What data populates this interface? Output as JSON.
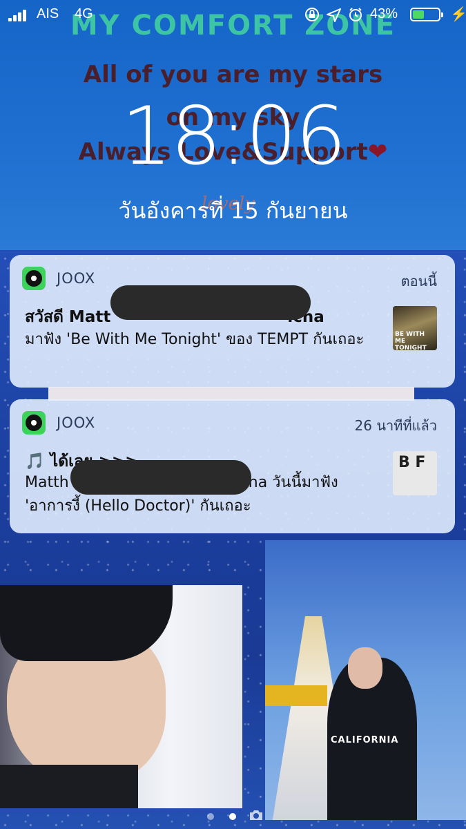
{
  "status": {
    "carrier": "AIS",
    "network": "4G",
    "battery_percent": "43%",
    "battery_level": 0.43,
    "icons": [
      "lock-rotation-icon",
      "location-icon",
      "alarm-icon"
    ]
  },
  "wallpaper": {
    "title": "MY COMFORT ZONE",
    "line1": "All of you are my stars",
    "line2": "on my sky",
    "line3": "Always Love&Support",
    "heart": "❤",
    "signature": "lovely"
  },
  "lockscreen": {
    "time": "18:06",
    "date": "วันอังคารที่ 15 กันยายน"
  },
  "notifications": [
    {
      "app": "JOOX",
      "time": "ตอนนี้",
      "title_start": "สวัสดี Matt",
      "title_end": "icha",
      "body": "มาฟัง 'Be With Me Tonight'  ของ TEMPT กันเถอะ",
      "thumb_text": "BE WITH ME TONIGHT"
    },
    {
      "app": "JOOX",
      "time": "26 นาทีที่แล้ว",
      "title": "🎵 ได้เลย >>>",
      "body_start": "Matth",
      "body_end": "cha วันนี้มาฟัง",
      "body_line2": "'อาการงี้ (Hello Doctor)' กันเถอะ",
      "thumb_text": "B F"
    }
  ],
  "photos": {
    "shirt_text": "CALIFORNIA"
  },
  "page_dots": {
    "count": 2,
    "active": 2,
    "camera_icon": "camera-icon"
  }
}
